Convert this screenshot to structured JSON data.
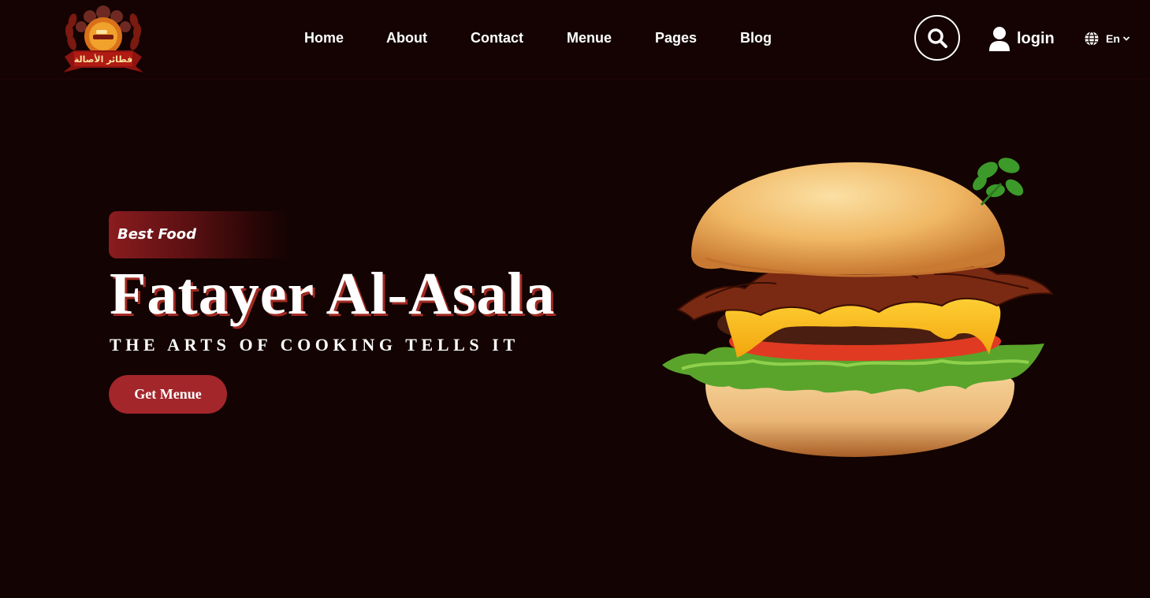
{
  "header": {
    "logo_text": "فطائر الأصالة",
    "nav": [
      {
        "label": "Home"
      },
      {
        "label": "About"
      },
      {
        "label": "Contact"
      },
      {
        "label": "Menue"
      },
      {
        "label": "Pages"
      },
      {
        "label": "Blog"
      }
    ],
    "search_icon": "search-icon",
    "login": {
      "icon": "user-icon",
      "label": "login"
    },
    "language": {
      "icon": "globe-icon",
      "label": "En",
      "dropdown_icon": "chevron-down-icon"
    }
  },
  "hero": {
    "badge": "Best Food",
    "title": "Fatayer Al-Asala",
    "subtitle": "THE ARTS OF COOKING TELLS IT",
    "cta_label": "Get Menue",
    "image": "burger-image"
  },
  "colors": {
    "background": "#130302",
    "accent": "#a3262b",
    "text": "#ffffff"
  }
}
